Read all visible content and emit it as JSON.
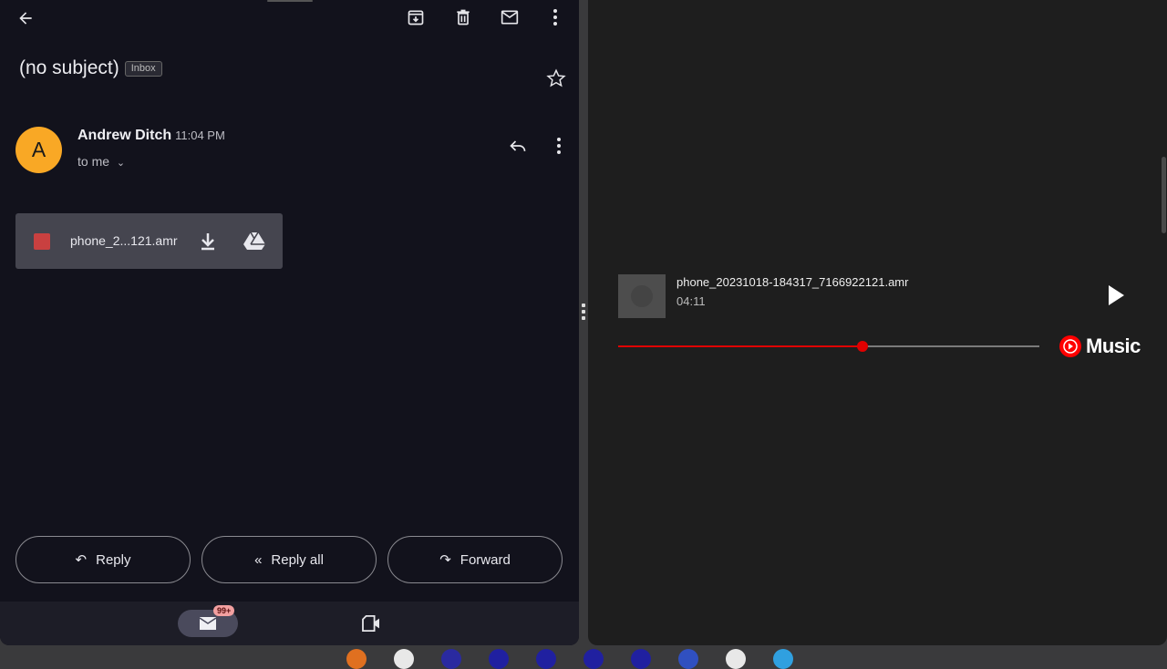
{
  "email": {
    "subject": "(no subject)",
    "label": "Inbox",
    "sender": "Andrew Ditch",
    "time": "11:04 PM",
    "recipient": "to me",
    "avatar_letter": "A",
    "avatar_color": "#f9a825",
    "attachment": {
      "name": "phone_2...121.amr"
    },
    "toolbar": [
      "back-icon",
      "archive-icon",
      "delete-icon",
      "mark-unread-icon",
      "more-icon"
    ],
    "actions": {
      "reply": "Reply",
      "reply_all": "Reply all",
      "forward": "Forward"
    },
    "bottom_nav": {
      "mail_badge": "99+"
    }
  },
  "player": {
    "title": "phone_20231018-184317_7166922121.amr",
    "duration": "04:11",
    "progress_percent": 58,
    "brand": "Music",
    "accent": "#e00000"
  }
}
